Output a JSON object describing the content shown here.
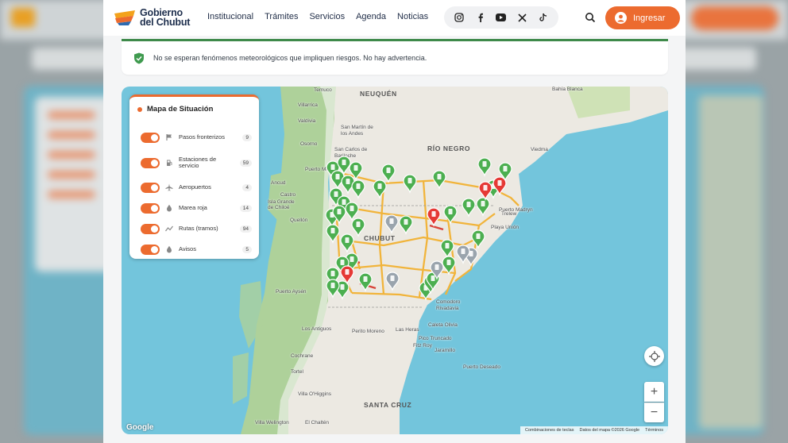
{
  "header": {
    "logo_line1": "Gobierno",
    "logo_line2": "del Chubut",
    "nav": [
      "Institucional",
      "Trámites",
      "Servicios",
      "Agenda",
      "Noticias"
    ],
    "social_icons": [
      "instagram-icon",
      "facebook-icon",
      "youtube-icon",
      "x-icon",
      "tiktok-icon"
    ],
    "login_label": "Ingresar"
  },
  "alert": {
    "text": "No se esperan fenómenos meteorológicos que impliquen riesgos. No hay advertencia."
  },
  "legend": {
    "title": "Mapa de Situación",
    "items": [
      {
        "label": "Pasos fronterizos",
        "count": "9",
        "icon": "flag-icon"
      },
      {
        "label": "Estaciones de servicio",
        "count": "59",
        "icon": "fuel-icon"
      },
      {
        "label": "Aeropuertos",
        "count": "4",
        "icon": "plane-icon"
      },
      {
        "label": "Marea roja",
        "count": "14",
        "icon": "drop-icon"
      },
      {
        "label": "Rutas (tramos)",
        "count": "94",
        "icon": "route-icon"
      },
      {
        "label": "Avisos",
        "count": "5",
        "icon": "drop-icon"
      }
    ]
  },
  "map": {
    "regions": [
      "NEUQUÉN",
      "RÍO NEGRO",
      "CHUBUT",
      "SANTA CRUZ"
    ],
    "places": [
      "Temuco",
      "Villarrica",
      "Valdivia",
      "Osorno",
      "Puerto Montt",
      "Ancud",
      "Castro",
      "Isla Grande de Chiloé",
      "Quellón",
      "San Martín de los Andes",
      "San Carlos de Bariloche",
      "Puerto Aysén",
      "Los Antiguos",
      "Cochrane",
      "Tortel",
      "Villa O'Higgins",
      "El Chaltén",
      "Villa Welington",
      "Perito Moreno",
      "Las Heras",
      "Caleta Olivia",
      "Pico Truncado",
      "Fitz Roy",
      "Jaramillo",
      "Puerto Deseado",
      "Comodoro Rivadavia",
      "Trelew",
      "Puerto Madryn",
      "Playa Unión",
      "Bahía Blanca",
      "Viedma"
    ],
    "attribution": [
      "Combinaciones de teclas",
      "Datos del mapa ©2026 Google",
      "Términos"
    ],
    "google": "Google",
    "zoom_in": "+",
    "zoom_out": "−"
  },
  "colors": {
    "accent": "#ec6b2f",
    "navy": "#1e2f4d",
    "green_marker": "#4caf50",
    "red_marker": "#e53935",
    "gray_marker": "#9aa4ad"
  }
}
